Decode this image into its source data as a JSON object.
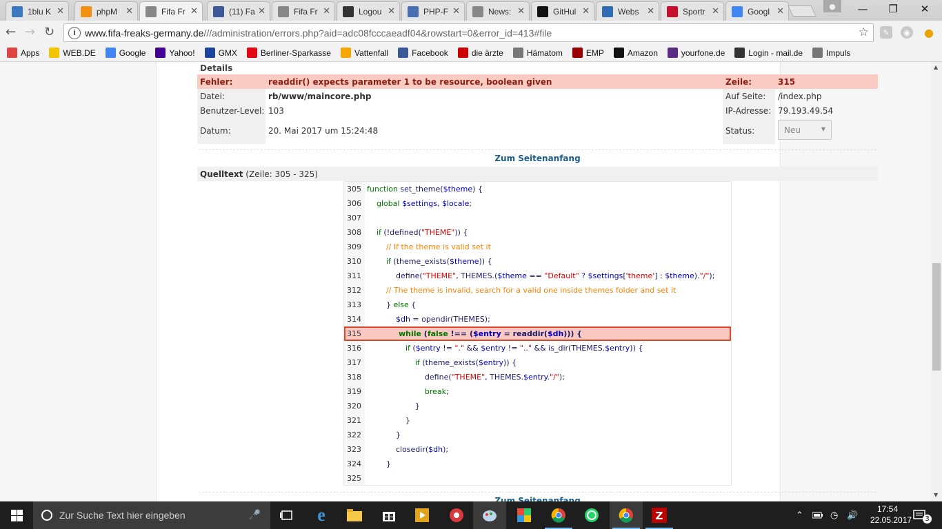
{
  "tabs": [
    {
      "title": "1blu K",
      "favicon": "1blu",
      "color": "#3a7bbf"
    },
    {
      "title": "phpM",
      "favicon": "pma",
      "color": "#f29111"
    },
    {
      "title": "Fifa Fr",
      "favicon": "fifa",
      "color": "#888888"
    },
    {
      "title": "(11) Fa",
      "favicon": "facebook",
      "color": "#3b5998"
    },
    {
      "title": "Fifa Fr",
      "favicon": "fifa",
      "color": "#888888"
    },
    {
      "title": "Logou",
      "favicon": "logout",
      "color": "#333333"
    },
    {
      "title": "PHP-F",
      "favicon": "php",
      "color": "#4a6fb5"
    },
    {
      "title": "News:",
      "favicon": "fifa",
      "color": "#888888"
    },
    {
      "title": "GitHul",
      "favicon": "github",
      "color": "#111111"
    },
    {
      "title": "Webs",
      "favicon": "webs",
      "color": "#2e6db4"
    },
    {
      "title": "Sportr",
      "favicon": "k",
      "color": "#c8102e"
    },
    {
      "title": "Googl",
      "favicon": "google",
      "color": "#4285f4"
    }
  ],
  "address": {
    "domain": "www.fifa-freaks-germany.de",
    "path": "///administration/errors.php?aid=adc08fcccaeadf04&rowstart=0&error_id=413#file"
  },
  "bookmarks": [
    {
      "label": "Apps",
      "icon": "apps-grid"
    },
    {
      "label": "WEB.DE",
      "icon": "webde"
    },
    {
      "label": "Google",
      "icon": "google"
    },
    {
      "label": "Yahoo!",
      "icon": "yahoo"
    },
    {
      "label": "GMX",
      "icon": "gmx"
    },
    {
      "label": "Berliner-Sparkasse",
      "icon": "sparkasse"
    },
    {
      "label": "Vattenfall",
      "icon": "vattenfall"
    },
    {
      "label": "Facebook",
      "icon": "facebook"
    },
    {
      "label": "die ärzte",
      "icon": "aerzte"
    },
    {
      "label": "Hämatom",
      "icon": "page"
    },
    {
      "label": "EMP",
      "icon": "emp"
    },
    {
      "label": "Amazon",
      "icon": "amazon"
    },
    {
      "label": "yourfone.de",
      "icon": "yourfone"
    },
    {
      "label": "Login - mail.de",
      "icon": "maildel"
    },
    {
      "label": "Impuls",
      "icon": "page"
    }
  ],
  "details": {
    "heading": "Details",
    "error_label": "Fehler:",
    "error_text": "readdir() expects parameter 1 to be resource, boolean given",
    "line_label": "Zeile:",
    "line_value": "315",
    "file_label": "Datei:",
    "file_value": "rb/www/maincore.php",
    "page_label": "Auf Seite:",
    "page_value": "/index.php",
    "level_label": "Benutzer-Level:",
    "level_value": "103",
    "ip_label": "IP-Adresse:",
    "ip_value": "79.193.49.54",
    "date_label": "Datum:",
    "date_value": "20. Mai 2017 um 15:24:48",
    "status_label": "Status:",
    "status_value": "Neu"
  },
  "top_link": "Zum Seitenanfang",
  "source": {
    "heading": "Quelltext",
    "range": "(Zeile: 305 - 325)"
  },
  "code_lines": [
    {
      "n": "305",
      "code": "function set_theme($theme) {"
    },
    {
      "n": "306",
      "code": "    global $settings, $locale;"
    },
    {
      "n": "307",
      "code": ""
    },
    {
      "n": "308",
      "code": "    if (!defined(\"THEME\")) {"
    },
    {
      "n": "309",
      "code": "        // If the theme is valid set it"
    },
    {
      "n": "310",
      "code": "        if (theme_exists($theme)) {"
    },
    {
      "n": "311",
      "code": "            define(\"THEME\", THEMES.($theme == \"Default\" ? $settings['theme'] : $theme).\"/\");"
    },
    {
      "n": "312",
      "code": "        // The theme is invalid, search for a valid one inside themes folder and set it"
    },
    {
      "n": "313",
      "code": "        } else {"
    },
    {
      "n": "314",
      "code": "            $dh = opendir(THEMES);"
    },
    {
      "n": "315",
      "code": "            while (false !== ($entry = readdir($dh))) {"
    },
    {
      "n": "316",
      "code": "                if ($entry != \".\" && $entry != \"..\" && is_dir(THEMES.$entry)) {"
    },
    {
      "n": "317",
      "code": "                    if (theme_exists($entry)) {"
    },
    {
      "n": "318",
      "code": "                        define(\"THEME\", THEMES.$entry.\"/\");"
    },
    {
      "n": "319",
      "code": "                        break;"
    },
    {
      "n": "320",
      "code": "                    }"
    },
    {
      "n": "321",
      "code": "                }"
    },
    {
      "n": "322",
      "code": "            }"
    },
    {
      "n": "323",
      "code": "            closedir($dh);"
    },
    {
      "n": "324",
      "code": "        }"
    },
    {
      "n": "325",
      "code": ""
    }
  ],
  "taskbar": {
    "search_placeholder": "Zur Suche Text hier eingeben",
    "time": "17:54",
    "date": "22.05.2017",
    "notifications": "3"
  }
}
